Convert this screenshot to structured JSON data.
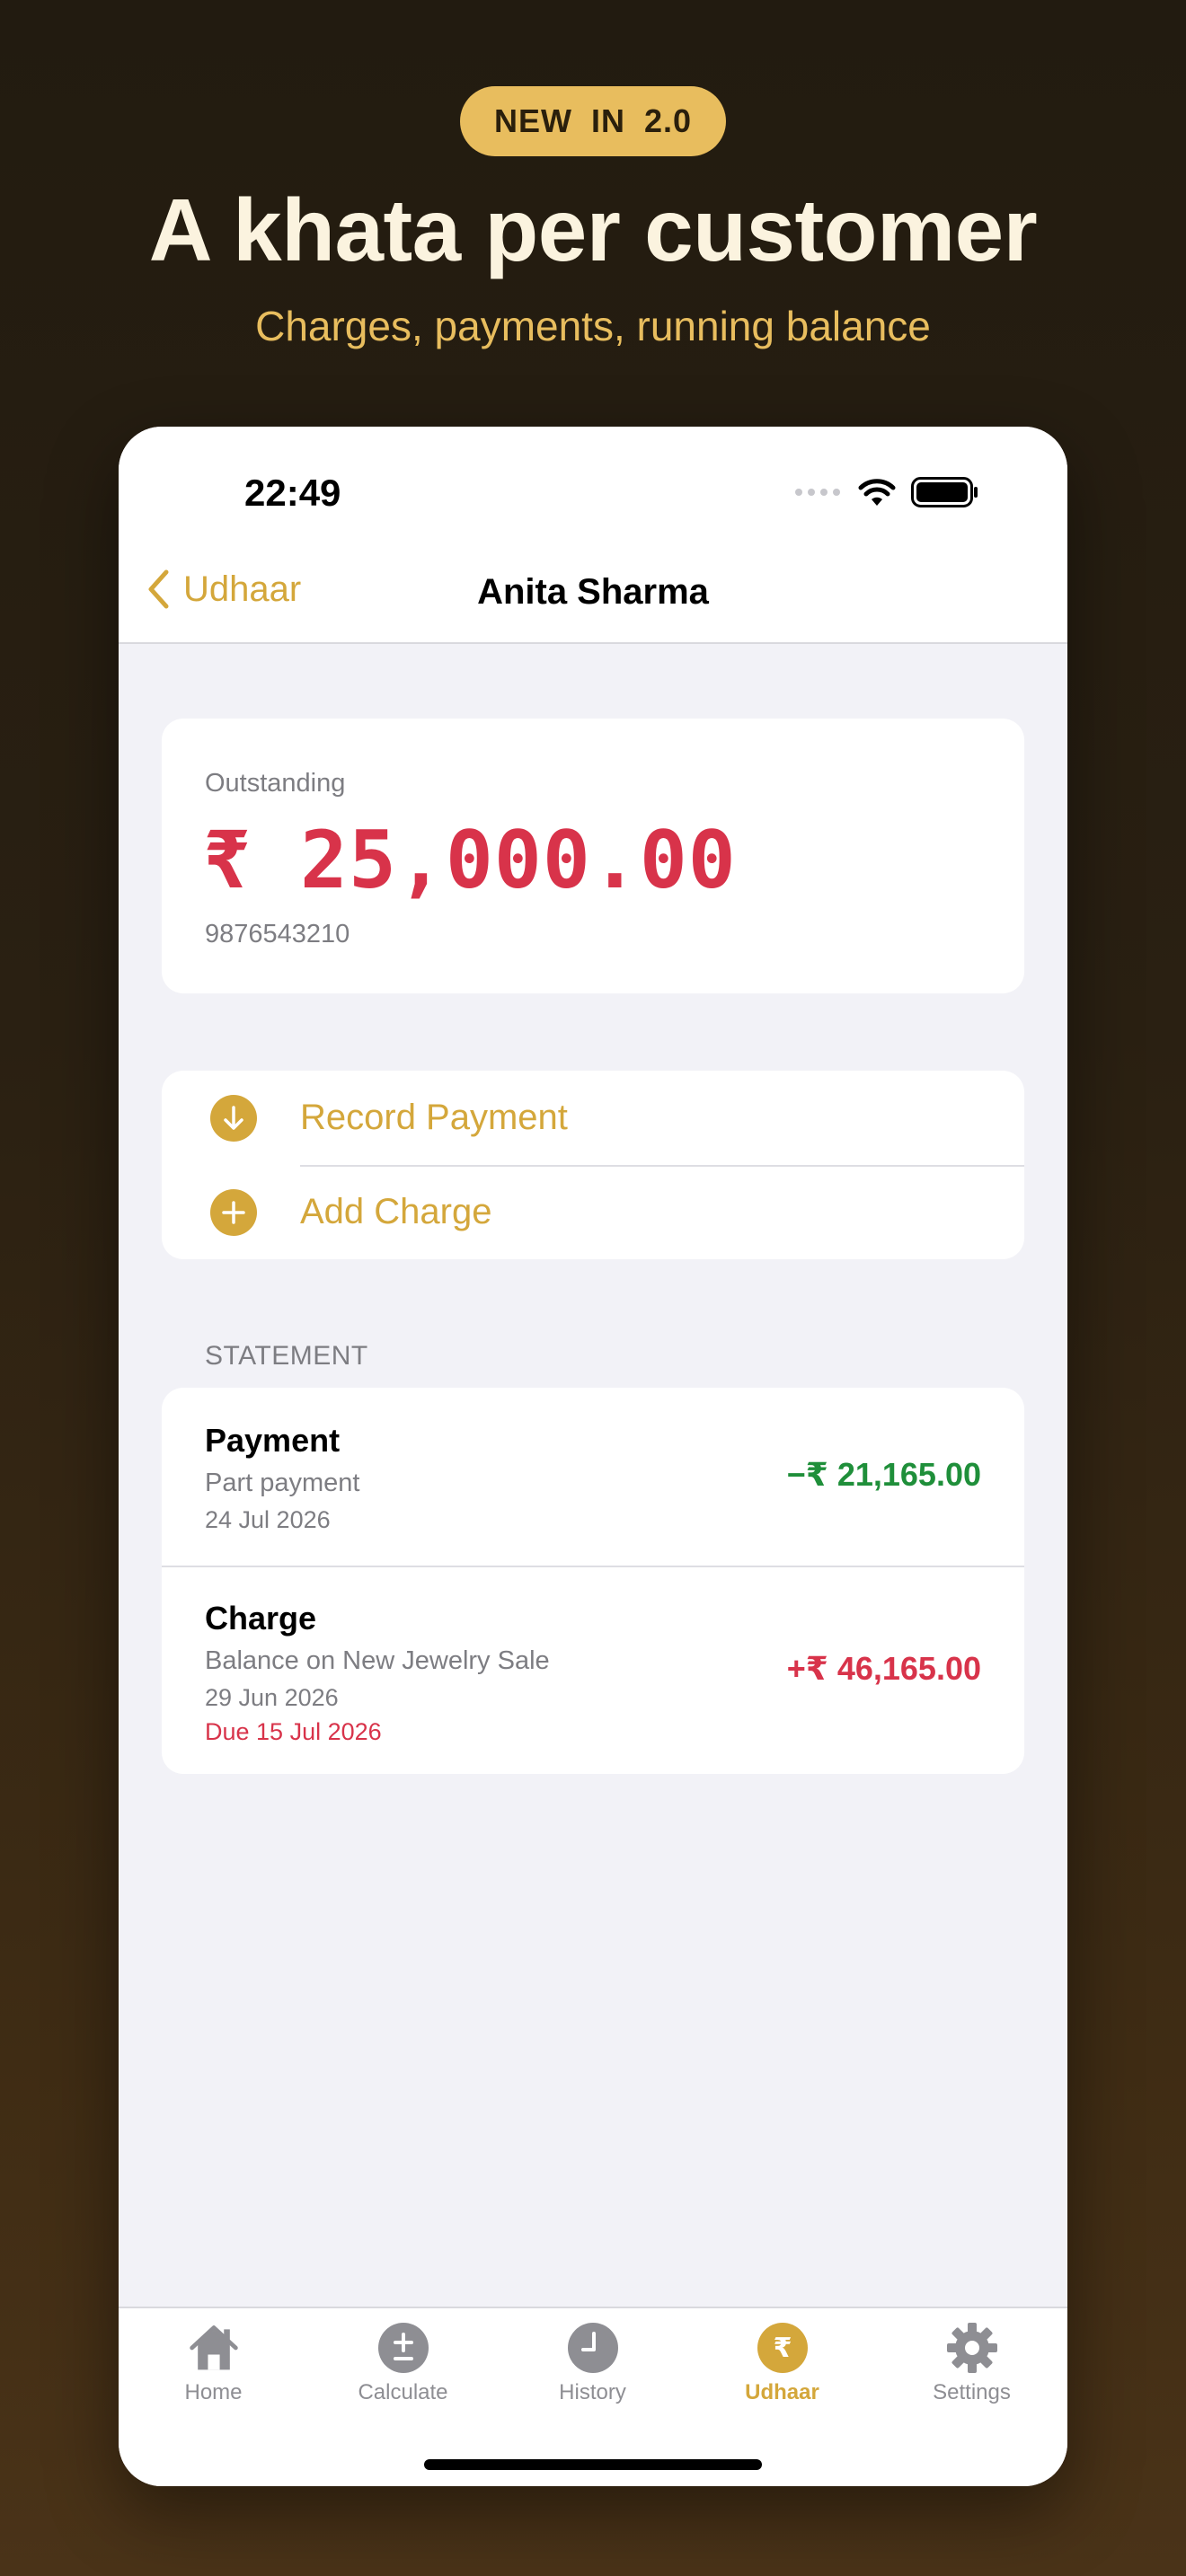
{
  "promo": {
    "badge": "NEW  IN  2.0",
    "headline": "A khata per customer",
    "subhead": "Charges, payments, running balance"
  },
  "status_bar": {
    "time": "22:49"
  },
  "nav": {
    "back_label": "Udhaar",
    "title": "Anita Sharma"
  },
  "outstanding": {
    "label": "Outstanding",
    "amount": "₹ 25,000.00",
    "phone": "9876543210"
  },
  "actions": [
    {
      "label": "Record Payment",
      "icon": "arrow-down-circle-icon"
    },
    {
      "label": "Add Charge",
      "icon": "plus-circle-icon"
    }
  ],
  "statement": {
    "header": "STATEMENT",
    "entries": [
      {
        "title": "Payment",
        "subtitle": "Part payment",
        "date": "24 Jul 2026",
        "due": "",
        "amount": "−₹ 21,165.00",
        "color": "#1f8f3a"
      },
      {
        "title": "Charge",
        "subtitle": "Balance on New Jewelry Sale",
        "date": "29 Jun 2026",
        "due": "Due 15 Jul 2026",
        "amount": "+₹ 46,165.00",
        "color": "#d8334a"
      }
    ]
  },
  "tabs": [
    {
      "label": "Home",
      "icon": "house-icon",
      "active": false
    },
    {
      "label": "Calculate",
      "icon": "plus-minus-icon",
      "active": false
    },
    {
      "label": "History",
      "icon": "clock-icon",
      "active": false
    },
    {
      "label": "Udhaar",
      "icon": "rupee-icon",
      "active": true
    },
    {
      "label": "Settings",
      "icon": "gear-icon",
      "active": false
    }
  ],
  "colors": {
    "accent": "#d4a73b",
    "negative": "#d8334a",
    "positive": "#1f8f3a"
  }
}
